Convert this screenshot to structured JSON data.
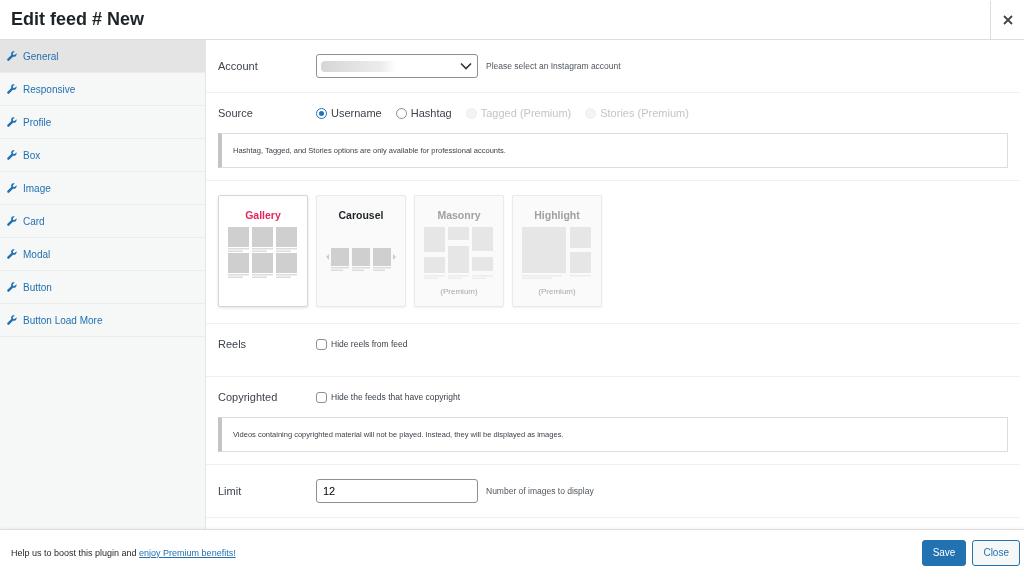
{
  "window": {
    "title": "Edit feed # New"
  },
  "sidebar": {
    "items": [
      {
        "label": "General",
        "selected": true
      },
      {
        "label": "Responsive",
        "selected": false
      },
      {
        "label": "Profile",
        "selected": false
      },
      {
        "label": "Box",
        "selected": false
      },
      {
        "label": "Image",
        "selected": false
      },
      {
        "label": "Card",
        "selected": false
      },
      {
        "label": "Modal",
        "selected": false
      },
      {
        "label": "Button",
        "selected": false
      },
      {
        "label": "Button Load More",
        "selected": false
      }
    ]
  },
  "account": {
    "label": "Account",
    "help": "Please select an Instagram account"
  },
  "source": {
    "label": "Source",
    "options": [
      {
        "label": "Username",
        "selected": true,
        "disabled": false
      },
      {
        "label": "Hashtag",
        "selected": false,
        "disabled": false
      },
      {
        "label": "Tagged (Premium)",
        "selected": false,
        "disabled": true
      },
      {
        "label": "Stories (Premium)",
        "selected": false,
        "disabled": true
      }
    ],
    "notice": "Hashtag, Tagged, and Stories options are only available for professional accounts."
  },
  "layouts": [
    {
      "title": "Gallery",
      "kind": "gallery",
      "selected": true,
      "disabled": false
    },
    {
      "title": "Carousel",
      "kind": "carousel",
      "selected": false,
      "disabled": false
    },
    {
      "title": "Masonry",
      "kind": "masonry",
      "selected": false,
      "disabled": true,
      "note": "(Premium)"
    },
    {
      "title": "Highlight",
      "kind": "highlight",
      "selected": false,
      "disabled": true,
      "note": "(Premium)"
    }
  ],
  "reels": {
    "label": "Reels",
    "checkbox": "Hide reels from feed",
    "checked": false
  },
  "copyrighted": {
    "label": "Copyrighted",
    "checkbox": "Hide the feeds that have copyright",
    "checked": false,
    "notice": "Videos containing copyrighted material will not be played. Instead, they will be displayed as images."
  },
  "limit": {
    "label": "Limit",
    "value": "12",
    "help": "Number of images to display"
  },
  "footer": {
    "text": "Help us to boost this plugin and ",
    "link": "enjoy Premium benefits!",
    "buttons": [
      {
        "label": "Save",
        "kind": "primary"
      },
      {
        "label": "Close",
        "kind": "secondary"
      }
    ]
  }
}
